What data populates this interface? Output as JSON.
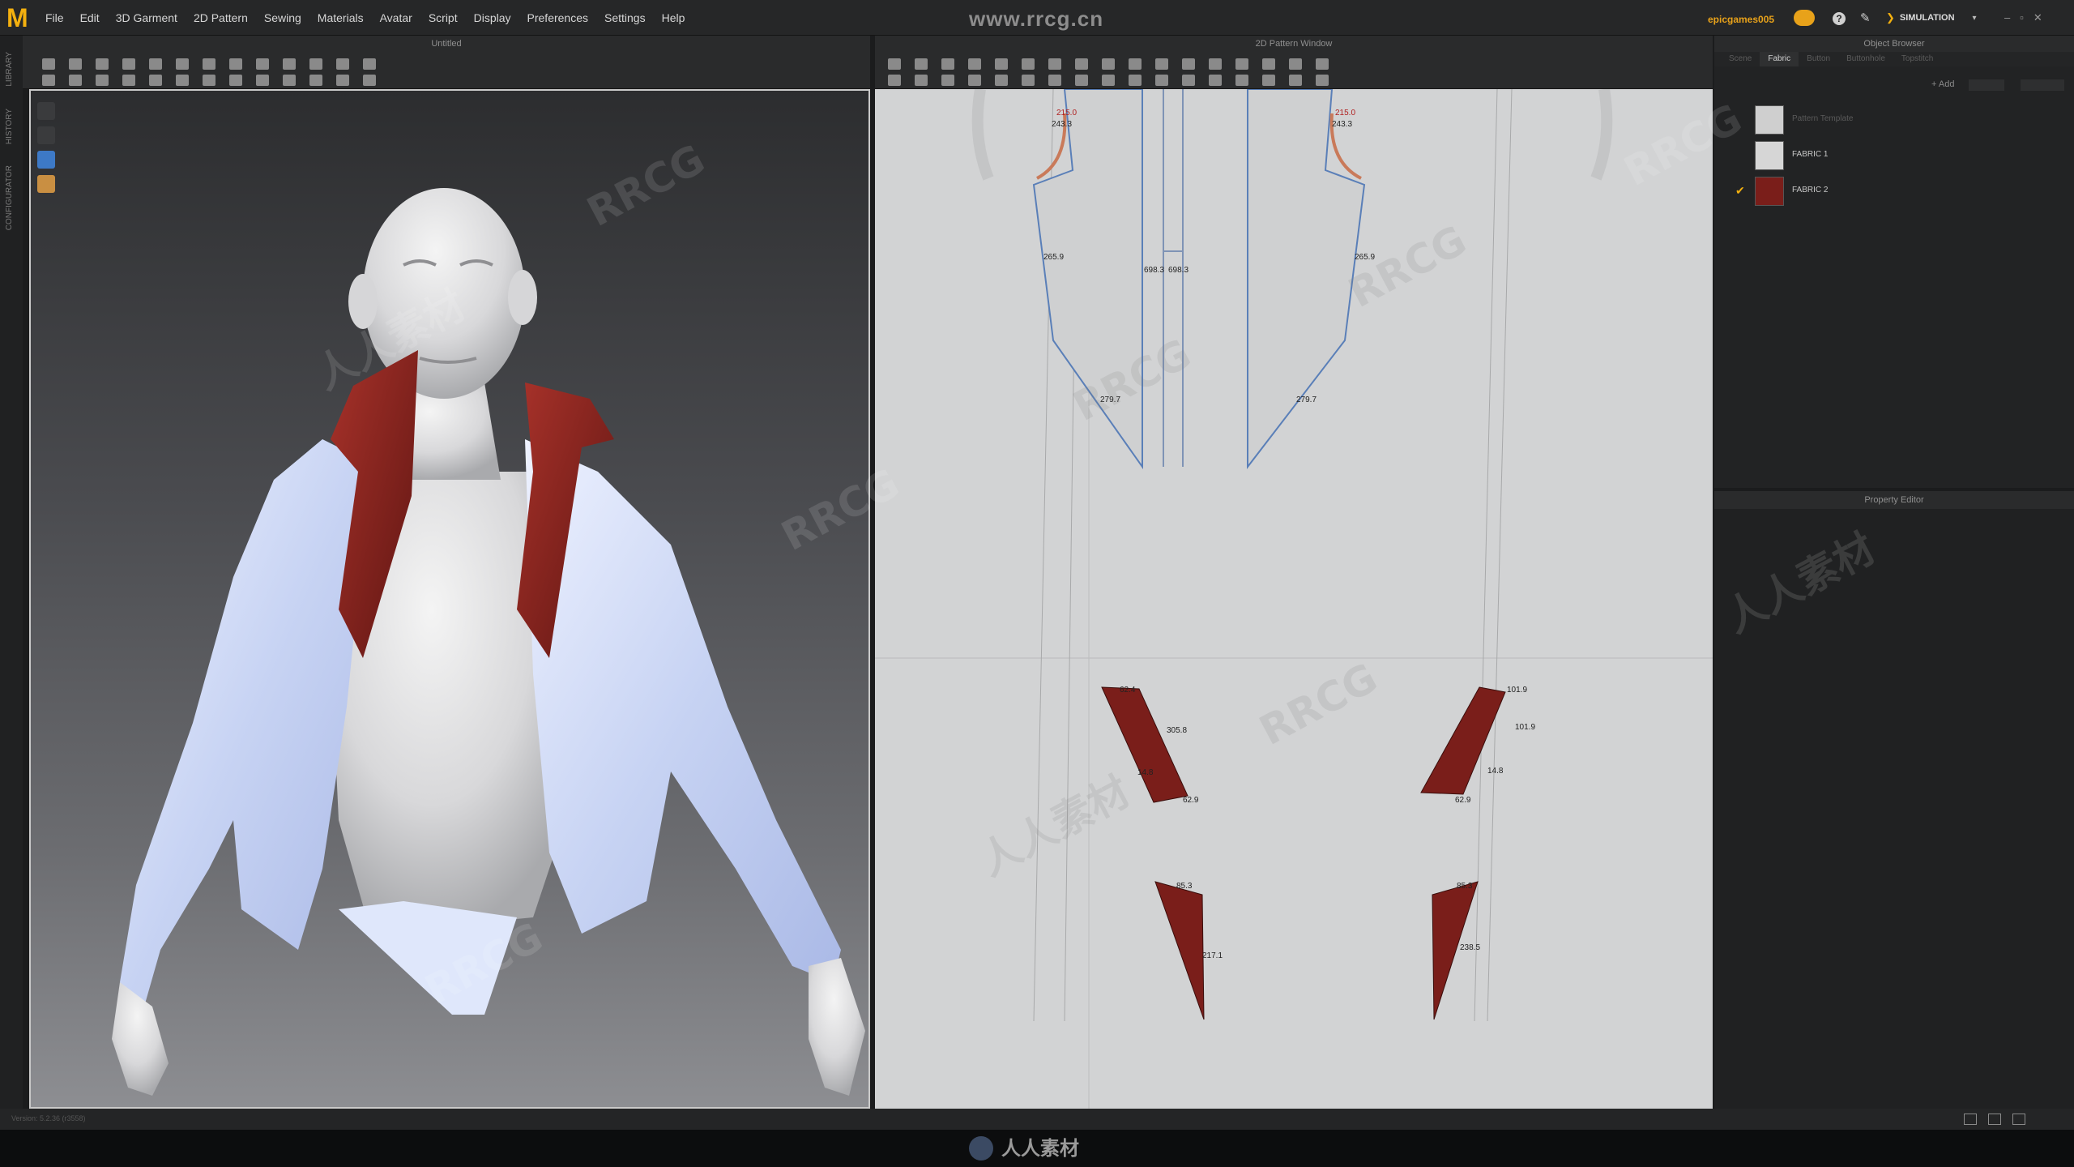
{
  "menubar": {
    "logo": "M",
    "items": [
      "File",
      "Edit",
      "3D Garment",
      "2D Pattern",
      "Sewing",
      "Materials",
      "Avatar",
      "Script",
      "Display",
      "Preferences",
      "Settings",
      "Help"
    ],
    "watermark_url": "www.rrcg.cn",
    "user": "epicgames005",
    "help_icon": "?",
    "mode": "SIMULATION",
    "mode_chevron": "❯",
    "mode_caret": "▾",
    "window_controls": [
      "–",
      "▫",
      "✕"
    ]
  },
  "left_strip": {
    "tabs": [
      "LIBRARY",
      "HISTORY",
      "CONFIGURATOR"
    ]
  },
  "window3d": {
    "title": "Untitled"
  },
  "window2d": {
    "title": "2D Pattern Window",
    "measurements": {
      "m1": "215.0",
      "m2": "243.3",
      "m3": "215.0",
      "m4": "243.3",
      "m5": "265.9",
      "m6": "265.9",
      "m7": "698.3",
      "m8": "698.3",
      "m9": "279.7",
      "m10": "279.7",
      "m11": "62.4",
      "m12": "101.9",
      "m13": "101.9",
      "m14": "305.8",
      "m15": "14.8",
      "m16": "14.8",
      "m17": "62.9",
      "m18": "62.9",
      "m19": "85.3",
      "m20": "85.3",
      "m21": "217.1",
      "m22": "238.5"
    }
  },
  "object_browser": {
    "title": "Object Browser",
    "tabs": [
      "Scene",
      "Fabric",
      "Button",
      "Buttonhole",
      "Topstitch"
    ],
    "active_tab": "Fabric",
    "add_label": "+ Add",
    "fabrics": [
      {
        "name": "Pattern Template",
        "color": "#cfcfcf",
        "selected": false,
        "dim": true
      },
      {
        "name": "FABRIC 1",
        "color": "#d6d6d6",
        "selected": false,
        "dim": false
      },
      {
        "name": "FABRIC 2",
        "color": "#7a1e1a",
        "selected": true,
        "dim": false
      }
    ],
    "checkmark": "✔"
  },
  "property_editor": {
    "title": "Property Editor"
  },
  "status": {
    "version": "Version: 5.2.36 (r3558)"
  },
  "footer": {
    "watermark": "人人素材"
  },
  "overlay_watermarks": [
    "RRCG",
    "人人素材"
  ],
  "colors": {
    "accent": "#f3b00f",
    "fabric2": "#7a1e1a",
    "pattern_line": "#5a7fb8"
  }
}
